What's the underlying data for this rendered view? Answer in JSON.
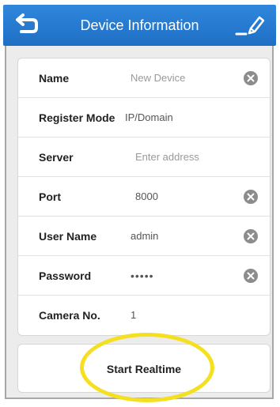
{
  "header": {
    "title": "Device Information",
    "back_icon": "back-arrow-icon",
    "edit_icon": "edit-pencil-icon",
    "background_color": "#2f87dc"
  },
  "form": {
    "rows": [
      {
        "label": "Name",
        "value": "New Device",
        "value_kind": "placeholder",
        "clear": true
      },
      {
        "label": "Register Mode",
        "value": "IP/Domain",
        "value_kind": "value",
        "clear": false
      },
      {
        "label": "Server",
        "value": "Enter address",
        "value_kind": "placeholder",
        "clear": false
      },
      {
        "label": "Port",
        "value": "8000",
        "value_kind": "value",
        "clear": true
      },
      {
        "label": "User Name",
        "value": "admin",
        "value_kind": "value",
        "clear": true
      },
      {
        "label": "Password",
        "value": "•••••",
        "value_kind": "value",
        "clear": true
      },
      {
        "label": "Camera No.",
        "value": "1",
        "value_kind": "value",
        "clear": false
      }
    ]
  },
  "actions": {
    "start_label": "Start Realtime"
  },
  "annotation": {
    "highlight_color": "#f4e020"
  }
}
